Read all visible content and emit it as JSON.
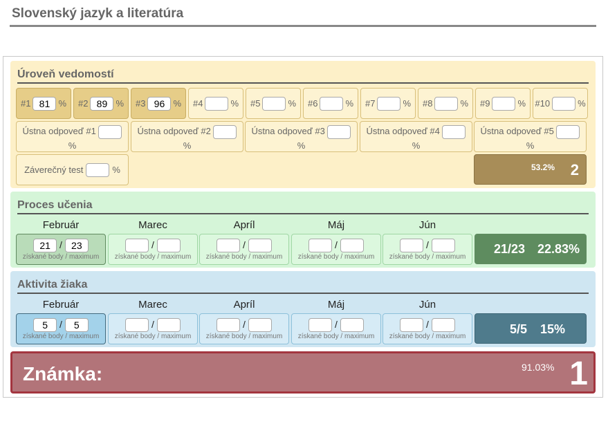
{
  "page_title": "Slovenský jazyk a literatúra",
  "knowledge": {
    "title": "Úroveň vedomostí",
    "pct_sign": "%",
    "tests": [
      {
        "label": "#1",
        "value": "81"
      },
      {
        "label": "#2",
        "value": "89"
      },
      {
        "label": "#3",
        "value": "96"
      },
      {
        "label": "#4",
        "value": ""
      },
      {
        "label": "#5",
        "value": ""
      },
      {
        "label": "#6",
        "value": ""
      },
      {
        "label": "#7",
        "value": ""
      },
      {
        "label": "#8",
        "value": ""
      },
      {
        "label": "#9",
        "value": ""
      },
      {
        "label": "#10",
        "value": ""
      }
    ],
    "oral": [
      {
        "label": "Ústna odpoveď #1",
        "value": ""
      },
      {
        "label": "Ústna odpoveď #2",
        "value": ""
      },
      {
        "label": "Ústna odpoveď #3",
        "value": ""
      },
      {
        "label": "Ústna odpoveď #4",
        "value": ""
      },
      {
        "label": "Ústna odpoveď #5",
        "value": ""
      }
    ],
    "final_test": {
      "label": "Záverečný test",
      "value": ""
    },
    "result": {
      "percent": "53.2%",
      "grade": "2"
    }
  },
  "process": {
    "title": "Proces učenia",
    "months": [
      {
        "name": "Február",
        "got": "21",
        "max": "23"
      },
      {
        "name": "Marec",
        "got": "",
        "max": ""
      },
      {
        "name": "Apríl",
        "got": "",
        "max": ""
      },
      {
        "name": "Máj",
        "got": "",
        "max": ""
      },
      {
        "name": "Jún",
        "got": "",
        "max": ""
      }
    ],
    "hint": "získané body / maximum",
    "result": {
      "ratio": "21/23",
      "percent": "22.83%"
    }
  },
  "activity": {
    "title": "Aktivita žiaka",
    "months": [
      {
        "name": "Február",
        "got": "5",
        "max": "5"
      },
      {
        "name": "Marec",
        "got": "",
        "max": ""
      },
      {
        "name": "Apríl",
        "got": "",
        "max": ""
      },
      {
        "name": "Máj",
        "got": "",
        "max": ""
      },
      {
        "name": "Jún",
        "got": "",
        "max": ""
      }
    ],
    "hint": "získané body / maximum",
    "result": {
      "ratio": "5/5",
      "percent": "15%"
    }
  },
  "final": {
    "label": "Známka:",
    "percent": "91.03%",
    "grade": "1"
  }
}
